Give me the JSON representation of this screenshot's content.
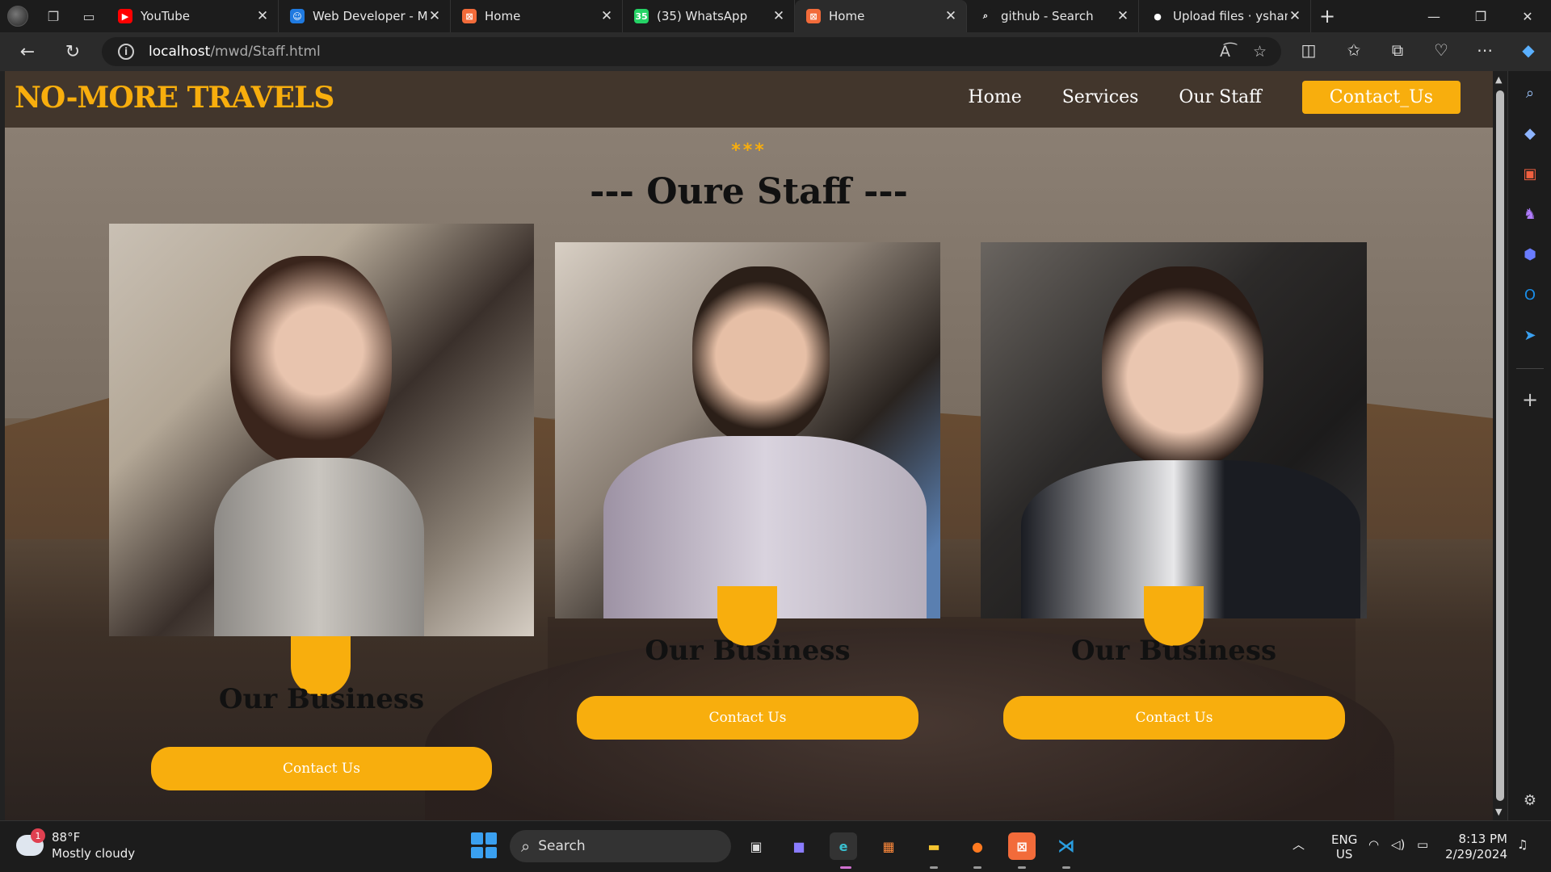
{
  "browser": {
    "tabs": [
      {
        "title": "YouTube",
        "color": "#ff0000",
        "glyph": "▶",
        "active": false
      },
      {
        "title": "Web Developer - M",
        "color": "#1f7ae0",
        "glyph": "☺",
        "active": false
      },
      {
        "title": "Home",
        "color": "#f26b3a",
        "glyph": "⊠",
        "active": false
      },
      {
        "title": "(35) WhatsApp",
        "color": "#25d366",
        "glyph": "35",
        "active": false
      },
      {
        "title": "Home",
        "color": "#f26b3a",
        "glyph": "⊠",
        "active": true
      },
      {
        "title": "github - Search",
        "color": "#1c1c1c",
        "glyph": "⌕",
        "active": false
      },
      {
        "title": "Upload files · ysham",
        "color": "#1c1c1c",
        "glyph": "●",
        "active": false
      }
    ],
    "url_host": "localhost",
    "url_path": "/mwd/Staff.html"
  },
  "site": {
    "logo": "NO-MORE TRAVELS",
    "nav": {
      "home": "Home",
      "services": "Services",
      "our_staff": "Our Staff",
      "contact": "Contact_Us"
    },
    "stars": "***",
    "heading": "--- Oure Staff ---",
    "cards": [
      {
        "caption": "Our Business",
        "button": "Contact Us"
      },
      {
        "caption": "Our Business",
        "button": "Contact Us"
      },
      {
        "caption": "Our Business",
        "button": "Contact Us"
      }
    ],
    "accent": "#f8ae0d"
  },
  "taskbar": {
    "weather_temp": "88°F",
    "weather_desc": "Mostly cloudy",
    "weather_badge": "1",
    "search_label": "Search",
    "lang_top": "ENG",
    "lang_bottom": "US",
    "time": "8:13 PM",
    "date": "2/29/2024"
  }
}
